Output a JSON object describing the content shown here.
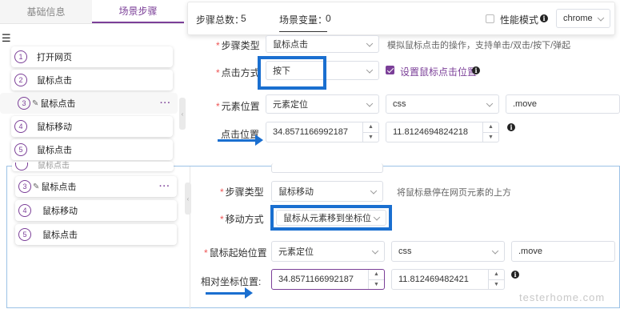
{
  "tabs": [
    {
      "label": "基础信息"
    },
    {
      "label": "场景步骤"
    }
  ],
  "steps": [
    {
      "num": "1",
      "label": "打开网页"
    },
    {
      "num": "2",
      "label": "鼠标点击"
    },
    {
      "num": "3",
      "label": "鼠标点击"
    },
    {
      "num": "4",
      "label": "鼠标移动"
    },
    {
      "num": "5",
      "label": "鼠标点击"
    }
  ],
  "steps2": [
    {
      "num": "3",
      "label": "鼠标点击"
    },
    {
      "num": "4",
      "label": "鼠标移动"
    },
    {
      "num": "5",
      "label": "鼠标点击"
    }
  ],
  "partial_step": "鼠标点击",
  "more_label": "···",
  "infobar": {
    "steps_total_label": "步骤总数：",
    "steps_total_value": "5",
    "scene_var_label": "场景变量：",
    "scene_var_value": "0",
    "perf_mode_label": "性能模式",
    "browser": "chrome"
  },
  "form1": {
    "step_type_label": "步骤类型",
    "step_type_value": "鼠标点击",
    "step_type_hint": "模拟鼠标点击的操作，支持单击/双击/按下/弹起",
    "click_mode_label": "点击方式",
    "click_mode_value": "按下",
    "set_pos_label": "设置鼠标点击位置",
    "element_pos_label": "元素位置",
    "locate_by": "元素定位",
    "selector_type": "css",
    "selector_value": ".move",
    "click_pos_label": "点击位置",
    "x": "34.8571166992187",
    "y": "11.8124694824218"
  },
  "form2": {
    "step_type_label": "步骤类型",
    "step_type_value": "鼠标移动",
    "step_type_hint": "将鼠标悬停在网页元素的上方",
    "move_mode_label": "移动方式",
    "move_mode_value": "鼠标从元素移到坐标位",
    "start_pos_label": "鼠标起始位置",
    "locate_by": "元素定位",
    "selector_type": "css",
    "selector_value": ".move",
    "rel_pos_label": "相对坐标位置:",
    "x": "34.8571166992187",
    "y": "11.812469482421"
  },
  "watermark": "testerhome.com",
  "colors": {
    "accent": "#7b3f98",
    "highlight": "#1a6fd0",
    "required": "#e55555"
  }
}
